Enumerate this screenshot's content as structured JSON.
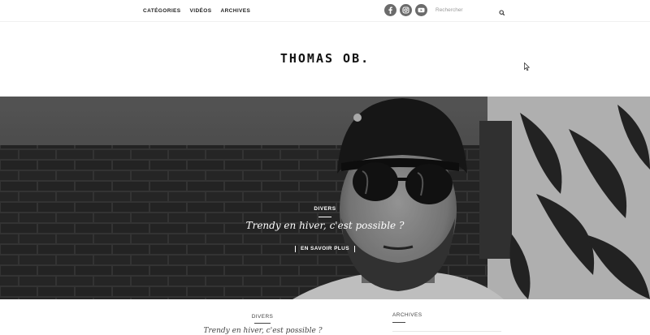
{
  "nav": {
    "items": [
      "CATÉGORIES",
      "VIDÉOS",
      "ARCHIVES"
    ]
  },
  "social": {
    "icons": [
      "facebook-icon",
      "instagram-icon",
      "youtube-icon"
    ],
    "color": "#6b6b6b"
  },
  "search": {
    "placeholder": "Rechercher"
  },
  "logo": {
    "text": "THOMAS OB."
  },
  "hero": {
    "category": "DIVERS",
    "title": "Trendy en hiver, c'est possible ?",
    "more_label": "EN SAVOIR PLUS"
  },
  "post": {
    "category": "DIVERS",
    "title": "Trendy en hiver, c'est possible ?"
  },
  "sidebar": {
    "title": "ARCHIVES"
  }
}
